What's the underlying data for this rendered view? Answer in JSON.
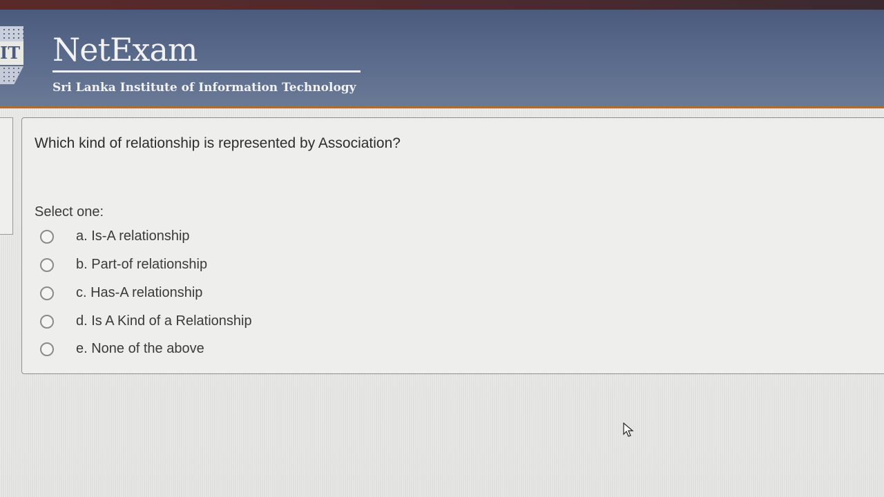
{
  "header": {
    "logo_letters": "IT",
    "title": "NetExam",
    "subtitle": "Sri Lanka Institute of Information Technology"
  },
  "question": {
    "text": "Which kind of relationship is represented by Association?",
    "prompt": "Select one:",
    "options": [
      {
        "label": "a.  Is-A relationship",
        "selected": false
      },
      {
        "label": "b. Part-of relationship",
        "selected": false
      },
      {
        "label": "c. Has-A relationship",
        "selected": false
      },
      {
        "label": "d. Is A Kind of a Relationship",
        "selected": false
      },
      {
        "label": "e. None of the above",
        "selected": false
      }
    ]
  },
  "colors": {
    "header_bg": "#5b6c8c",
    "header_border": "#b06a35",
    "header_text": "#f2f2f4",
    "page_bg": "#e4e4e2",
    "text": "#2d2d2d"
  },
  "icons": {
    "cursor": "mouse-pointer-icon",
    "radio": "radio-button-icon"
  }
}
